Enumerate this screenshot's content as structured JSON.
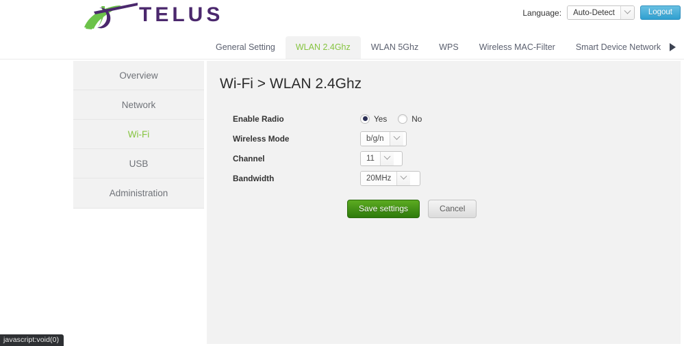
{
  "header": {
    "brand": "TELUS",
    "language_label": "Language:",
    "language_value": "Auto-Detect",
    "logout_label": "Logout"
  },
  "tabs": [
    {
      "label": "General Setting",
      "active": false
    },
    {
      "label": "WLAN 2.4Ghz",
      "active": true
    },
    {
      "label": "WLAN 5Ghz",
      "active": false
    },
    {
      "label": "WPS",
      "active": false
    },
    {
      "label": "Wireless MAC-Filter",
      "active": false
    },
    {
      "label": "Smart Device Network",
      "active": false
    }
  ],
  "sidebar": {
    "items": [
      {
        "label": "Overview",
        "active": false
      },
      {
        "label": "Network",
        "active": false
      },
      {
        "label": "Wi-Fi",
        "active": true
      },
      {
        "label": "USB",
        "active": false
      },
      {
        "label": "Administration",
        "active": false
      }
    ]
  },
  "main": {
    "title": "Wi-Fi > WLAN 2.4Ghz",
    "fields": {
      "enable_radio": {
        "label": "Enable Radio",
        "yes_label": "Yes",
        "no_label": "No",
        "value": "Yes"
      },
      "wireless_mode": {
        "label": "Wireless Mode",
        "value": "b/g/n"
      },
      "channel": {
        "label": "Channel",
        "value": "11"
      },
      "bandwidth": {
        "label": "Bandwidth",
        "value": "20MHz"
      }
    },
    "buttons": {
      "save_label": "Save settings",
      "cancel_label": "Cancel"
    }
  },
  "statusbar": {
    "text": "javascript:void(0)"
  },
  "colors": {
    "brand_purple": "#4b286d",
    "brand_green": "#86c440",
    "accent_blue": "#2f9fd0",
    "save_green": "#3f8f12",
    "panel_gray": "#f2f2f2"
  }
}
